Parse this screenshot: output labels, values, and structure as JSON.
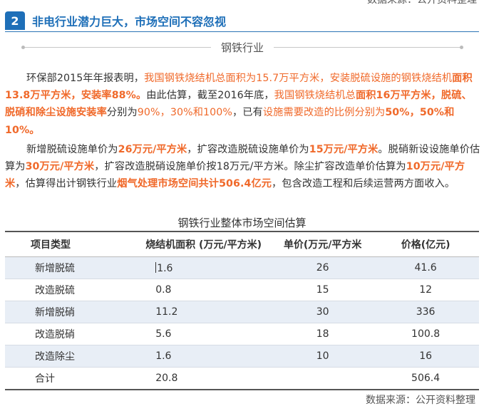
{
  "top_source": "数据来源：公开资料整理",
  "section": {
    "number": "2",
    "title": "非电行业潜力巨大，市场空间不容忽视"
  },
  "divider": {
    "label": "钢铁行业"
  },
  "p1": [
    {
      "text": "环保部2015年年报表明，",
      "style": ""
    },
    {
      "text": "我国钢铁烧结机总面积为15.7万平方米，安装脱硫设施的钢铁烧结机",
      "style": "orange"
    },
    {
      "text": "面积13.8万平方米，安装率88%。",
      "style": "orange b"
    },
    {
      "text": "由此估算，截至2016年底，",
      "style": ""
    },
    {
      "text": "我国钢铁烧结机总",
      "style": "orange"
    },
    {
      "text": "面积16万平方米，脱硫、脱硝和除尘设施安装率",
      "style": "orange b"
    },
    {
      "text": "分别为",
      "style": ""
    },
    {
      "text": "90%，30%和100%",
      "style": "orange"
    },
    {
      "text": "，已有",
      "style": ""
    },
    {
      "text": "设施需要改造的比例分别为",
      "style": "orange"
    },
    {
      "text": "50%，50%和10%。",
      "style": "orange b"
    }
  ],
  "p2": [
    {
      "text": "新增脱硫设施单价为",
      "style": ""
    },
    {
      "text": "26万元/平方米",
      "style": "orange b"
    },
    {
      "text": "，扩容改造脱硫设施单价为",
      "style": ""
    },
    {
      "text": "15万元/平方米",
      "style": "orange b"
    },
    {
      "text": "。脱硝新设设施单价估算为",
      "style": ""
    },
    {
      "text": "30万元/平方米",
      "style": "orange b"
    },
    {
      "text": "，扩容改造脱硝设施单价按18万元/平方米。除尘扩容改造单价估算为",
      "style": ""
    },
    {
      "text": "10万元/平方米",
      "style": "orange b"
    },
    {
      "text": "，估算得出计钢铁行业",
      "style": ""
    },
    {
      "text": "烟气处理市场空间共计506.4亿元",
      "style": "orange b"
    },
    {
      "text": "，包含改造工程和后续运营两方面收入。",
      "style": ""
    }
  ],
  "table": {
    "title": "钢铁行业整体市场空间估算",
    "headers": [
      "项目类型",
      "烧结机面积 (万元/平方米)",
      "单价(万元/平方米",
      "价格(亿元)"
    ],
    "rows": [
      [
        "新增脱硫",
        "1.6",
        "26",
        "41.6"
      ],
      [
        "改造脱硫",
        "0.8",
        "15",
        "12"
      ],
      [
        "新增脱硝",
        "11.2",
        "30",
        "336"
      ],
      [
        "改造脱硝",
        "5.6",
        "18",
        "100.8"
      ],
      [
        "改造除尘",
        "1.6",
        "10",
        "16"
      ],
      [
        "合计",
        "20.8",
        "",
        "506.4"
      ]
    ]
  },
  "footer_source": "数据来源：公开资料整理",
  "colors": {
    "accent_blue": "#1e6fb8",
    "highlight_orange": "#f0692a",
    "row_stripe": "#e8eef6"
  }
}
